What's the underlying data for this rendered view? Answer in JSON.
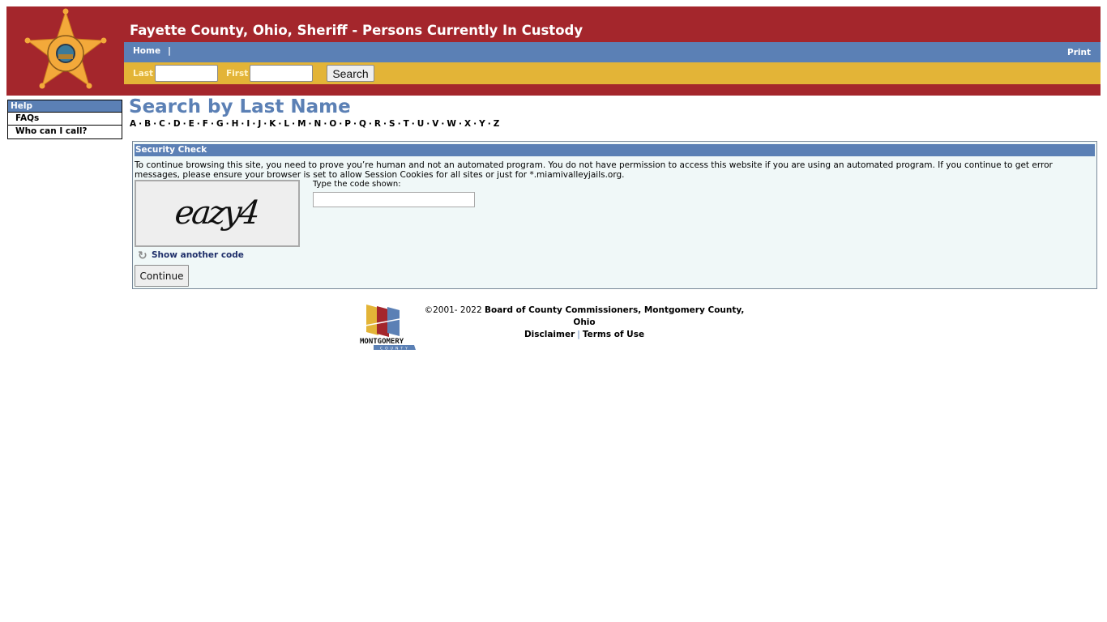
{
  "header": {
    "title": "Fayette County, Ohio, Sheriff - Persons Currently In Custody",
    "logo_icon": "sheriff-star-badge-icon",
    "colors": {
      "banner": "#a4262c",
      "nav": "#5b80b5",
      "search": "#e3b437"
    }
  },
  "nav": {
    "home_label": "Home",
    "separator": "|",
    "print_label": "Print"
  },
  "search": {
    "last_label": "Last",
    "last_value": "",
    "first_label": "First",
    "first_value": "",
    "button_label": "Search"
  },
  "sidebar": {
    "heading": "Help",
    "items": [
      {
        "label": "FAQs"
      },
      {
        "label": "Who can I call?"
      }
    ]
  },
  "main": {
    "title": "Search by Last Name",
    "letters": [
      "A",
      "B",
      "C",
      "D",
      "E",
      "F",
      "G",
      "H",
      "I",
      "J",
      "K",
      "L",
      "M",
      "N",
      "O",
      "P",
      "Q",
      "R",
      "S",
      "T",
      "U",
      "V",
      "W",
      "X",
      "Y",
      "Z"
    ]
  },
  "security": {
    "heading": "Security Check",
    "message": "To continue browsing this site, you need to prove you’re human and not an automated program. You do not have permission to access this website if you are using an automated program. If you continue to get error messages, please ensure your browser is set to allow Session Cookies for all sites or just for *.miamivalleyjails.org.",
    "captcha_text": "eazy4",
    "code_label": "Type the code shown:",
    "code_value": "",
    "refresh_label": "Show another code",
    "refresh_icon": "refresh-icon",
    "continue_label": "Continue"
  },
  "footer": {
    "copyright_prefix": "©2001- 2022",
    "owner": "Board of County Commissioners, Montgomery County, Ohio",
    "disclaimer_label": "Disclaimer",
    "separator": "|",
    "terms_label": "Terms of Use",
    "logo_text": "MONTGOMERY",
    "logo_subtext": "COUNTY"
  }
}
